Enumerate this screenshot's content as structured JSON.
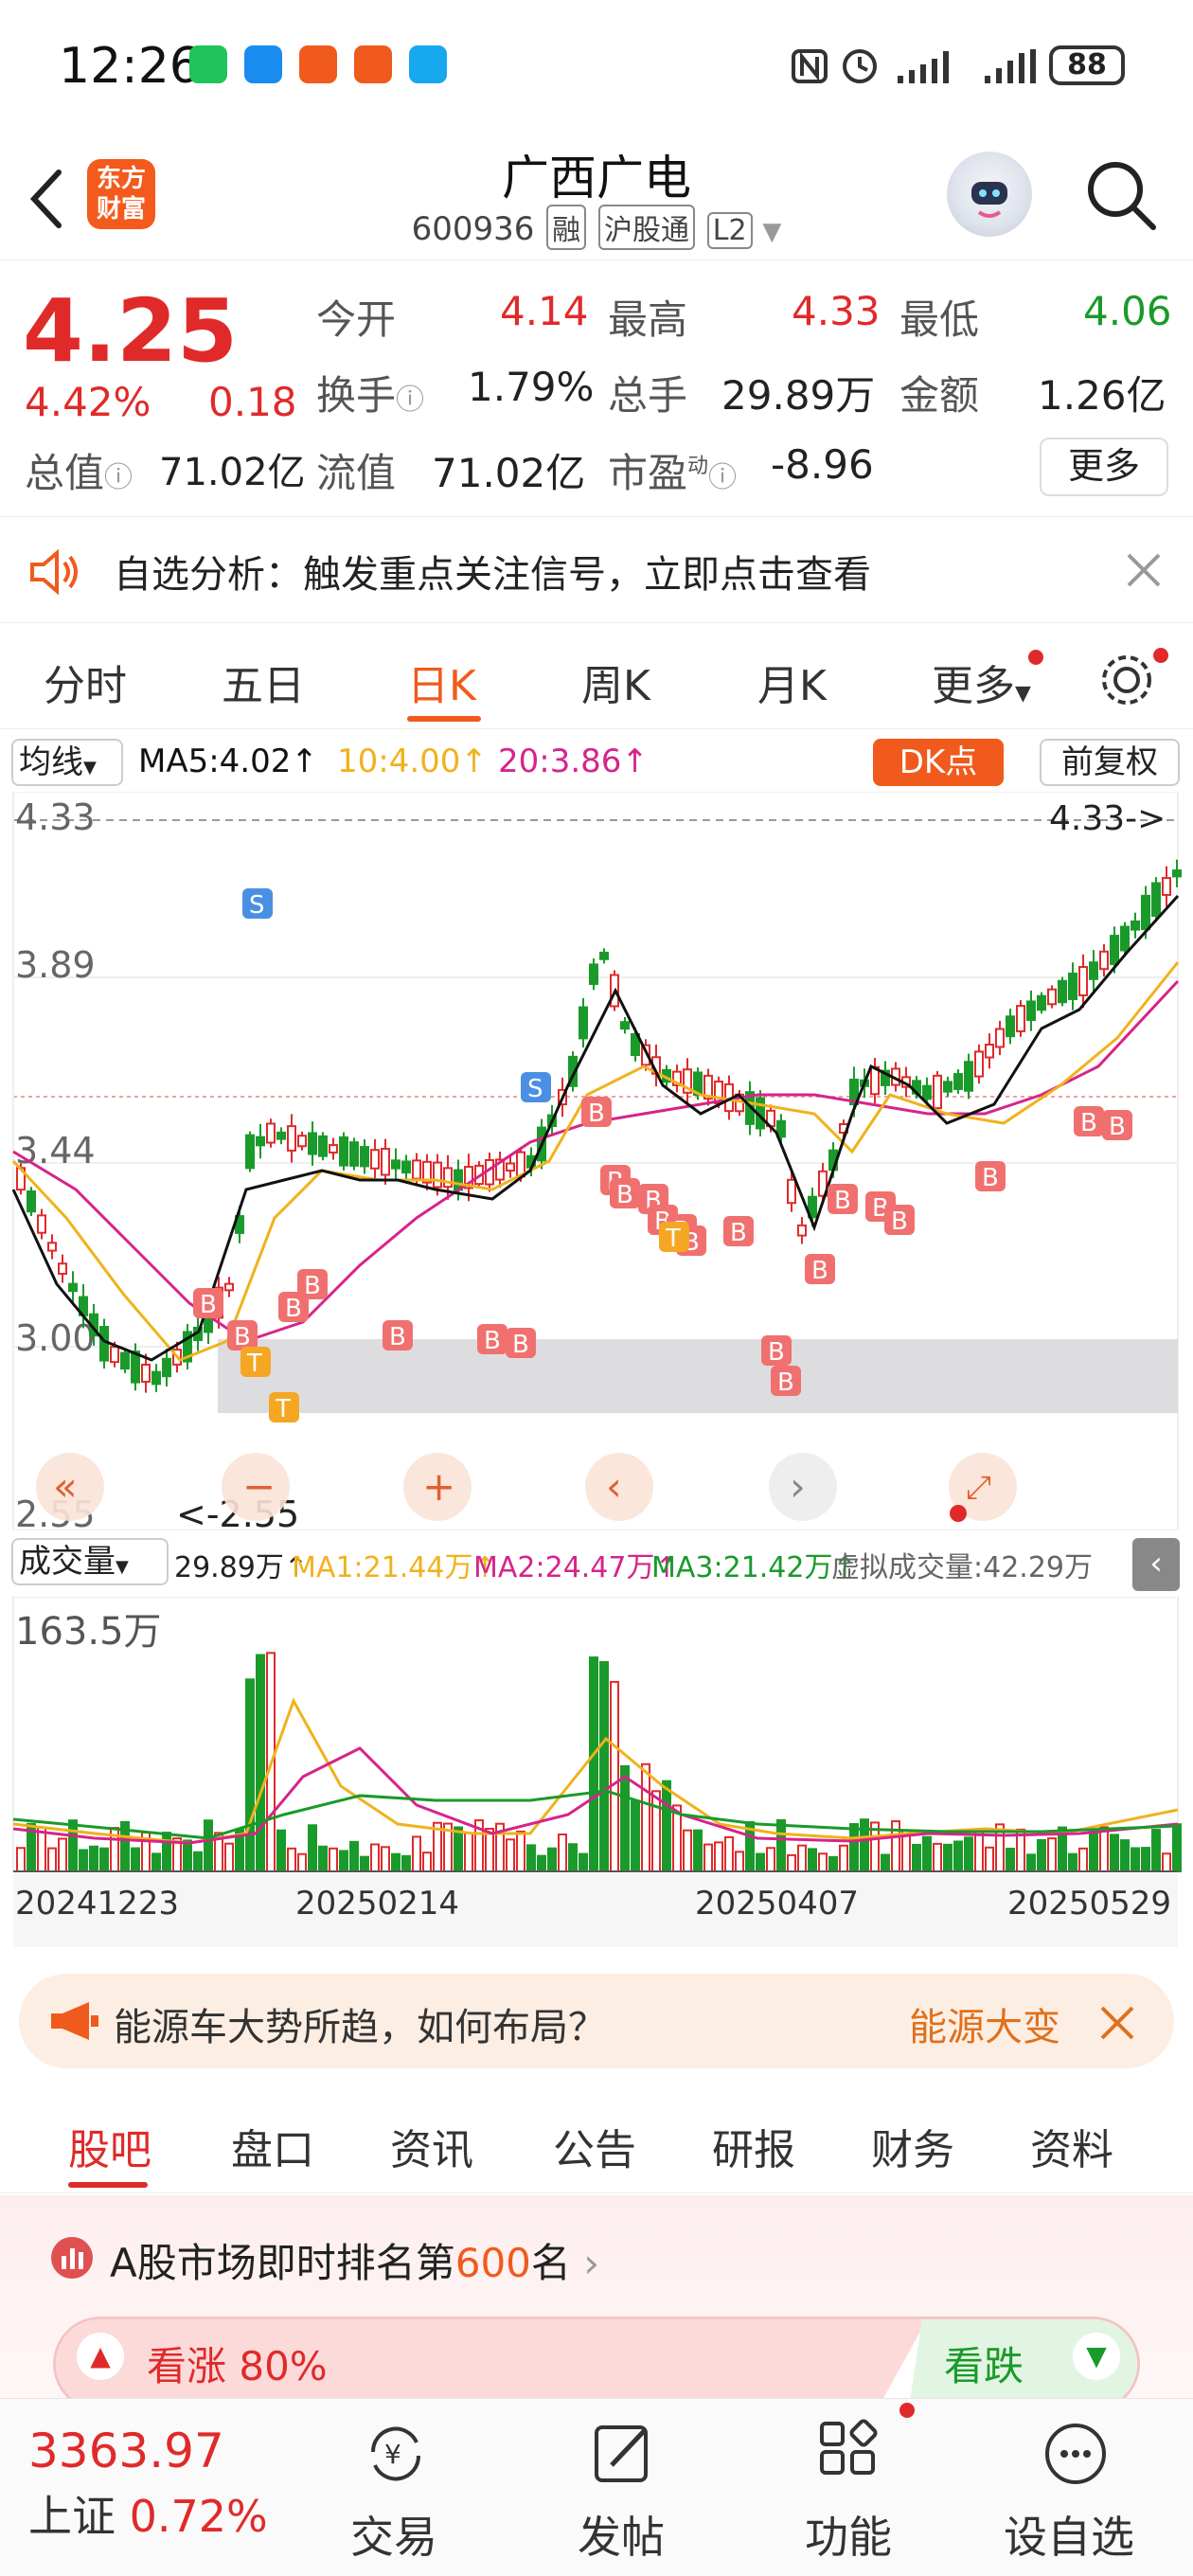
{
  "status_bar": {
    "time": "12:26",
    "battery": "88"
  },
  "header": {
    "logo_line1": "东方",
    "logo_line2": "财富",
    "stock_name": "广西广电",
    "stock_code": "600936",
    "tags": [
      "融",
      "沪股通",
      "L2"
    ]
  },
  "quote": {
    "price": "4.25",
    "change_pct": "4.42%",
    "change_amt": "0.18",
    "open_label": "今开",
    "open_value": "4.14",
    "high_label": "最高",
    "high_value": "4.33",
    "low_label": "最低",
    "low_value": "4.06",
    "turnover_label": "换手",
    "turnover_value": "1.79%",
    "volume_label": "总手",
    "volume_value": "29.89万",
    "amount_label": "金额",
    "amount_value": "1.26亿",
    "mktcap_label": "总值",
    "mktcap_value": "71.02亿",
    "float_label": "流值",
    "float_value": "71.02亿",
    "pe_label": "市盈",
    "pe_sup": "动",
    "pe_value": "-8.96",
    "more_label": "更多"
  },
  "analysis": {
    "text": "自选分析：触发重点关注信号，立即点击查看"
  },
  "chart_tabs": [
    "分时",
    "五日",
    "日K",
    "周K",
    "月K",
    "更多"
  ],
  "active_chart_tab": "日K",
  "ma_bar": {
    "select_label": "均线",
    "ma5": "MA5:4.02↑",
    "ma10": "10:4.00↑",
    "ma20": "20:3.86↑",
    "dk_label": "DK点",
    "adjust_label": "前复权"
  },
  "kchart_labels": {
    "y_ticks": [
      "4.33",
      "3.89",
      "3.44",
      "3.00",
      "2.55"
    ],
    "max_marker": "4.33->",
    "min_marker": "<-2.55"
  },
  "volume_bar": {
    "select_label": "成交量",
    "vol": "29.89万↑",
    "ma1": "MA1:21.44万↑",
    "ma2": "MA2:24.47万↑",
    "ma3": "MA3:21.42万↑",
    "virtual": "虚拟成交量:42.29万",
    "max_label": "163.5万"
  },
  "date_labels": [
    "20241223",
    "20250214",
    "20250407",
    "20250529"
  ],
  "ad_banner": {
    "text": "能源车大势所趋，如何布局？",
    "right_text": "能源大变"
  },
  "bottom_tabs": [
    "股吧",
    "盘口",
    "资讯",
    "公告",
    "研报",
    "财务",
    "资料"
  ],
  "active_bottom_tab": "股吧",
  "rank": {
    "prefix": "A股市场即时排名第",
    "rank": "600",
    "suffix": "名"
  },
  "vote": {
    "up_label": "看涨 80%",
    "down_label": "看跌"
  },
  "bottom_nav": {
    "index_value": "3363.97",
    "index_name": "上证",
    "index_change": "0.72%",
    "items": [
      "交易",
      "发帖",
      "功能",
      "设自选"
    ]
  },
  "colors": {
    "up": "#e02a2a",
    "down": "#1a9a2a",
    "accent": "#f05a1c",
    "ma5": "#111111",
    "ma10": "#f0b21c",
    "ma20": "#d6248a"
  }
}
